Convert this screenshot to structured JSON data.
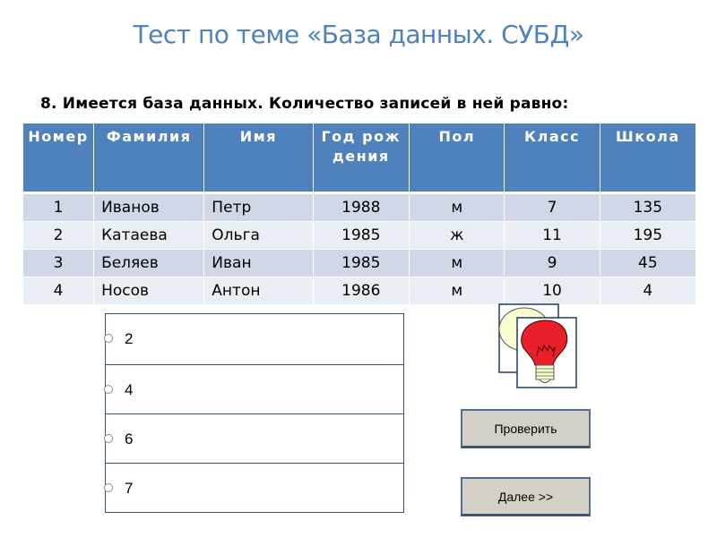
{
  "page": {
    "title": "Тест по теме «База данных. СУБД»",
    "question": "8. Имеется база данных. Количество записей в ней равно:"
  },
  "table": {
    "headers": [
      "Номер",
      "Фамилия",
      "Имя",
      "Год рождения",
      "Пол",
      "Класс",
      "Школа"
    ],
    "rows": [
      [
        "1",
        "Иванов",
        "Петр",
        "1988",
        "м",
        "7",
        "135"
      ],
      [
        "2",
        "Катаева",
        "Ольга",
        "1985",
        "ж",
        "11",
        "195"
      ],
      [
        "3",
        "Беляев",
        "Иван",
        "1985",
        "м",
        "9",
        "45"
      ],
      [
        "4",
        "Носов",
        "Антон",
        "1986",
        "м",
        "10",
        "4"
      ]
    ]
  },
  "answers": {
    "options": [
      {
        "label": "2",
        "selected": false
      },
      {
        "label": "4",
        "selected": false
      },
      {
        "label": "6",
        "selected": false
      },
      {
        "label": "7",
        "selected": false
      }
    ]
  },
  "icons": {
    "hint": "lightbulb-icon"
  },
  "buttons": {
    "check_label": "Проверить",
    "next_label": "Далее >>"
  },
  "colors": {
    "accent": "#4f81bd",
    "row_odd": "#d0d8e8",
    "row_even": "#e9edf4",
    "bulb_red": "#e8202a",
    "bulb_pale": "#fbfbd0",
    "button_bg": "#d4d0c8"
  }
}
